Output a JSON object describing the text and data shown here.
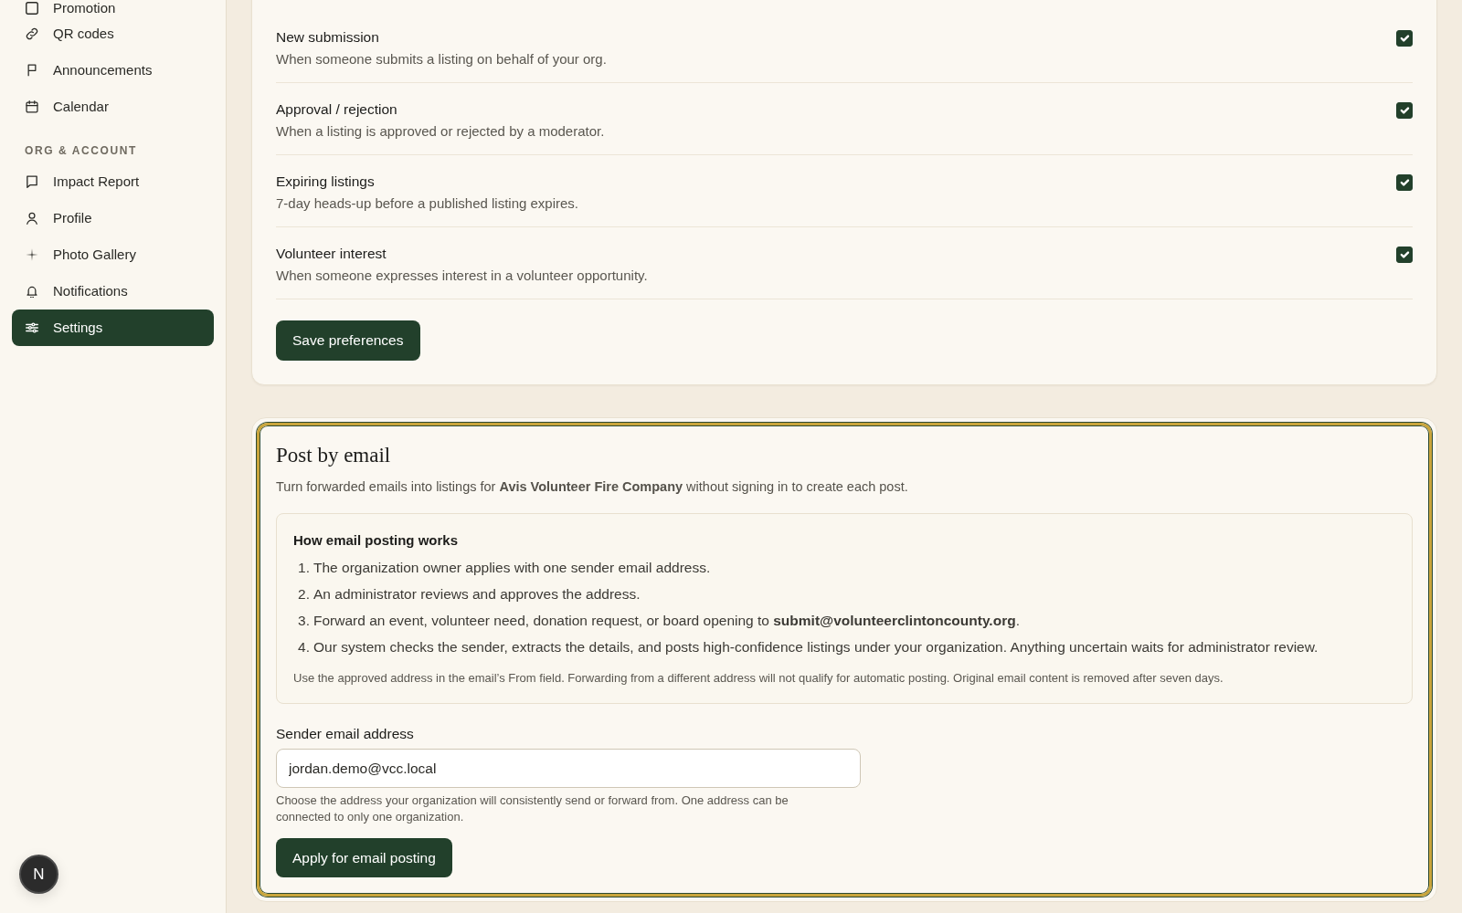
{
  "sidebar": {
    "sections": [
      {
        "items": [
          {
            "label": "Promotion",
            "selected": false
          },
          {
            "label": "QR codes",
            "selected": false
          },
          {
            "label": "Announcements",
            "selected": false
          },
          {
            "label": "Calendar",
            "selected": false
          }
        ]
      },
      {
        "heading": "ORG & ACCOUNT",
        "items": [
          {
            "label": "Impact Report",
            "selected": false
          },
          {
            "label": "Profile",
            "selected": false
          },
          {
            "label": "Photo Gallery",
            "selected": false
          },
          {
            "label": "Notifications",
            "selected": false
          },
          {
            "label": "Settings",
            "selected": true
          }
        ]
      }
    ]
  },
  "notification_preferences": {
    "options": [
      {
        "title": "New submission",
        "description": "When someone submits a listing on behalf of your org.",
        "checked": true
      },
      {
        "title": "Approval / rejection",
        "description": "When a listing is approved or rejected by a moderator.",
        "checked": true
      },
      {
        "title": "Expiring listings",
        "description": "7-day heads-up before a published listing expires.",
        "checked": true
      },
      {
        "title": "Volunteer interest",
        "description": "When someone expresses interest in a volunteer opportunity.",
        "checked": true
      }
    ],
    "save_button": "Save preferences"
  },
  "post_by_email": {
    "highlighted": true,
    "title": "Post by email",
    "intro": "Turn forwarded emails into listings for **Avis Volunteer Fire Company** without signing in to create each post.",
    "how_it_works": {
      "title": "How email posting works",
      "steps": [
        {
          "number": "1.",
          "text": "The organization owner applies with one sender email address."
        },
        {
          "number": "2.",
          "text": "An administrator reviews and approves the address."
        },
        {
          "number": "3.",
          "text": "Forward an event, volunteer need, donation request, or board opening to **submit@volunteerclintoncounty.org**."
        },
        {
          "number": "4.",
          "text": "Our system checks the sender, extracts the details, and posts high-confidence listings under your organization. Anything uncertain waits for administrator review."
        }
      ],
      "note": "Use the approved address in the email’s From field. Forwarding from a different address will not qualify for automatic posting. Original email content is removed after seven days."
    },
    "sender_field": {
      "label": "Sender email address",
      "value": "jordan.demo@vcc.local",
      "help": "Choose the address your organization will consistently send or forward from. One address can be connected to only one organization."
    },
    "apply_button": "Apply for email posting"
  },
  "dev_badge": {
    "label": "N"
  }
}
